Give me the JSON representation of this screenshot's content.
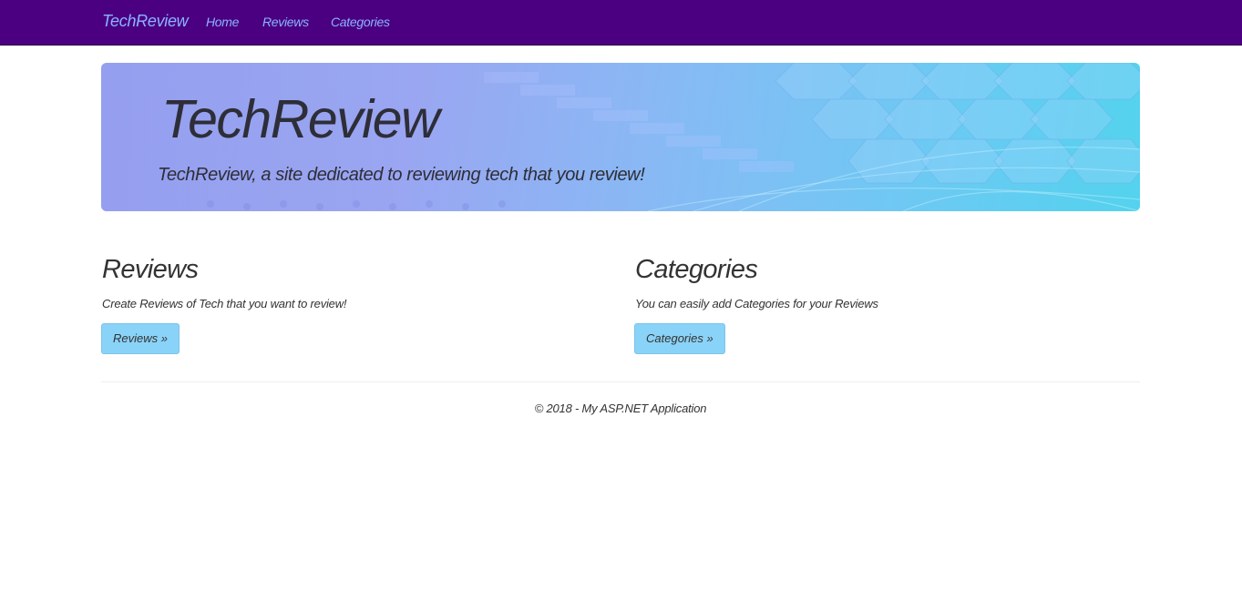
{
  "navbar": {
    "brand": "TechReview",
    "links": [
      {
        "label": "Home"
      },
      {
        "label": "Reviews"
      },
      {
        "label": "Categories"
      }
    ],
    "background_color": "#4b0082",
    "link_color": "#8ab4ff"
  },
  "jumbotron": {
    "title": "TechReview",
    "lead": "TechReview, a site dedicated to reviewing tech that you review!"
  },
  "sections": [
    {
      "heading": "Reviews",
      "description": "Create Reviews of Tech that you want to review!",
      "button_label": "Reviews »"
    },
    {
      "heading": "Categories",
      "description": "You can easily add Categories for your Reviews",
      "button_label": "Categories »"
    }
  ],
  "button_color": "#8ad3f8",
  "footer": {
    "text": "© 2018 - My ASP.NET Application"
  }
}
